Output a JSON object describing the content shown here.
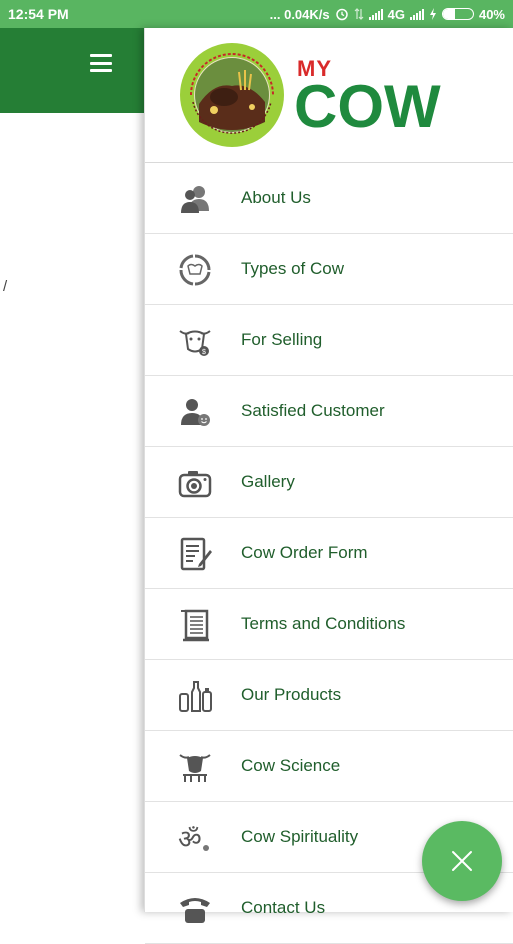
{
  "status_bar": {
    "time": "12:54 PM",
    "speed": "... 0.04K/s",
    "network": "4G",
    "battery": "40%",
    "battery_level": 0.4
  },
  "background": {
    "fragment_text": "/"
  },
  "drawer": {
    "brand_my": "MY",
    "brand_cow": "COW",
    "menu": [
      {
        "label": "About Us",
        "icon": "about-us-icon"
      },
      {
        "label": "Types of Cow",
        "icon": "types-of-cow-icon"
      },
      {
        "label": "For Selling",
        "icon": "for-selling-icon"
      },
      {
        "label": "Satisfied Customer",
        "icon": "satisfied-customer-icon"
      },
      {
        "label": "Gallery",
        "icon": "camera-icon"
      },
      {
        "label": "Cow Order Form",
        "icon": "order-form-icon"
      },
      {
        "label": "Terms and Conditions",
        "icon": "terms-document-icon"
      },
      {
        "label": "Our Products",
        "icon": "products-bottles-icon"
      },
      {
        "label": "Cow Science",
        "icon": "cow-science-icon"
      },
      {
        "label": "Cow Spirituality",
        "icon": "om-icon"
      },
      {
        "label": "Contact Us",
        "icon": "telephone-icon"
      }
    ]
  },
  "fab": {
    "icon": "close-icon"
  },
  "colors": {
    "status_bar": "#59b561",
    "toolbar": "#257e35",
    "menu_text": "#205e2c",
    "brand_red": "#d92a2a",
    "brand_green": "#1f8a3e",
    "fab": "#5aba62"
  }
}
